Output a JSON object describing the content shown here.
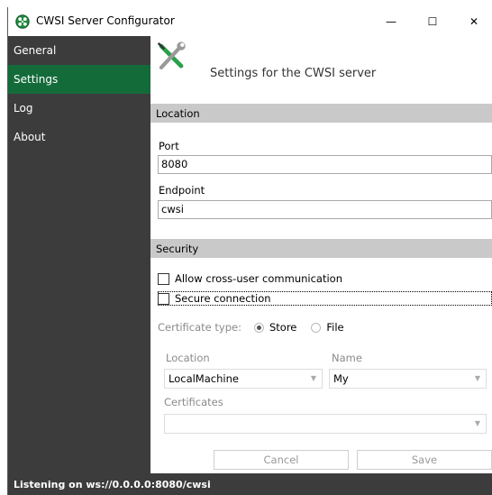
{
  "window": {
    "title": "CWSI Server Configurator",
    "icon": "cwsi-app-icon",
    "controls": {
      "minimize": "—",
      "maximize": "☐",
      "close": "✕"
    }
  },
  "sidebar": {
    "items": [
      {
        "label": "General",
        "active": false
      },
      {
        "label": "Settings",
        "active": true
      },
      {
        "label": "Log",
        "active": false
      },
      {
        "label": "About",
        "active": false
      }
    ],
    "accent_color": "#146b3a",
    "background_color": "#3c3c3c"
  },
  "header": {
    "title": "Settings for the CWSI server",
    "icon": "wrench-screwdriver-icon"
  },
  "location_section": {
    "title": "Location",
    "port_label": "Port",
    "port_value": "8080",
    "endpoint_label": "Endpoint",
    "endpoint_value": "cwsi"
  },
  "security_section": {
    "title": "Security",
    "cross_user_label": "Allow cross-user communication",
    "cross_user_checked": false,
    "secure_label": "Secure connection",
    "secure_checked": false,
    "certificate_type_label": "Certificate type:",
    "store_label": "Store",
    "file_label": "File",
    "selected_certificate_type": "Store",
    "location_label": "Location",
    "location_value": "LocalMachine",
    "name_label": "Name",
    "name_value": "My",
    "certificates_label": "Certificates",
    "certificates_value": ""
  },
  "actions": {
    "cancel_label": "Cancel",
    "save_label": "Save"
  },
  "status": {
    "text": "Listening on ws://0.0.0.0:8080/cwsi"
  }
}
